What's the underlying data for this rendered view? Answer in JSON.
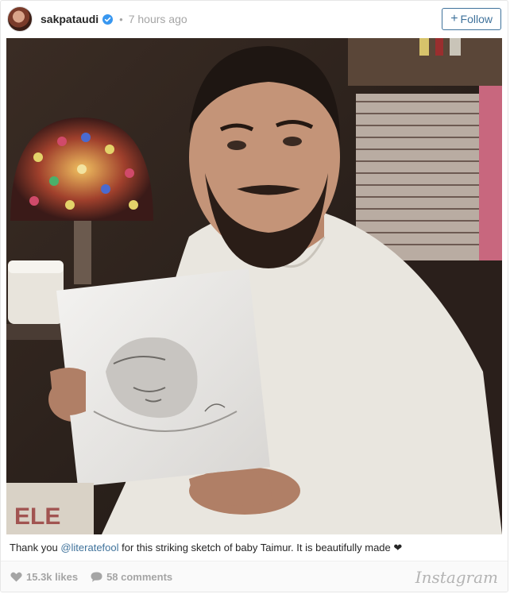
{
  "post": {
    "username": "sakpataudi",
    "separator": "•",
    "time_ago": "7 hours ago",
    "follow_label": "Follow",
    "follow_plus": "+"
  },
  "caption": {
    "before": "Thank you ",
    "mention": "@literatefool",
    "after": " for this striking sketch of baby Taimur. It is beautifully made ",
    "heart": "❤"
  },
  "footer": {
    "likes": "15.3k likes",
    "comments": "58 comments",
    "brand": "Instagram"
  },
  "colors": {
    "link": "#3f729b",
    "verified": "#3897f0",
    "muted": "#a5a5a5"
  },
  "icons": {
    "verified": "verified-badge-icon",
    "like": "heart-icon",
    "comment": "comment-bubble-icon"
  }
}
